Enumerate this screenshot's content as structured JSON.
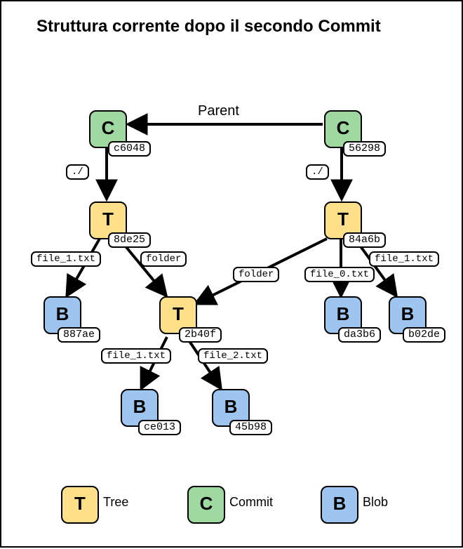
{
  "title": "Struttura corrente dopo il secondo Commit",
  "letters": {
    "C": "C",
    "T": "T",
    "B": "B"
  },
  "hashes": {
    "c1": "c6048",
    "c2": "56298",
    "t1": "8de25",
    "t2": "84a6b",
    "t3": "2b40f",
    "b1": "887ae",
    "b2": "da3b6",
    "b3": "b02de",
    "b4": "ce013",
    "b5": "45b98"
  },
  "labels": {
    "parent": "Parent",
    "root1": "./",
    "root2": "./",
    "file1a": "file_1.txt",
    "folder1": "folder",
    "folder2": "folder",
    "file0": "file_0.txt",
    "file1b": "file_1.txt",
    "file1c": "file_1.txt",
    "file2": "file_2.txt"
  },
  "legend": {
    "tree": "Tree",
    "commit": "Commit",
    "blob": "Blob"
  }
}
